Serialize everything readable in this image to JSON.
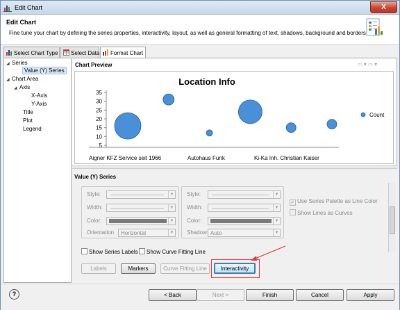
{
  "window": {
    "title": "Edit Chart",
    "close_label": "X"
  },
  "header": {
    "title": "Edit Chart",
    "description": "Fine tune your chart by defining the series properties, interactivity, layout, as well as general formatting of text, shadows, background and borders."
  },
  "tabs": [
    {
      "label": "Select Chart Type"
    },
    {
      "label": "Select Data"
    },
    {
      "label": "Format Chart"
    }
  ],
  "tree": {
    "series": "Series",
    "value_series": "Value (Y) Series",
    "chart_area": "Chart Area",
    "axis": "Axis",
    "x_axis": "X-Axis",
    "y_axis": "Y-Axis",
    "title": "Title",
    "plot": "Plot",
    "legend": "Legend"
  },
  "preview": {
    "heading": "Chart Preview",
    "nav_arrows": "⇦ ▾ ⇨ ▾"
  },
  "chart_data": {
    "type": "scatter",
    "title": "Location Info",
    "y_ticks": [
      5,
      10,
      15,
      20,
      25,
      30,
      35
    ],
    "ylim": [
      5,
      35
    ],
    "x_tick_labels": [
      "Aigner KFZ Service seit 1966",
      "Autohaus Funk",
      "Ki-Ka Inh. Christian Kaiser"
    ],
    "legend": "Count",
    "legend_position": "right",
    "series": [
      {
        "name": "Count",
        "color": "#4a90d9",
        "points": [
          {
            "x": 1,
            "y": 16,
            "size": 38
          },
          {
            "x": 2,
            "y": 31,
            "size": 16
          },
          {
            "x": 3,
            "y": 12,
            "size": 9
          },
          {
            "x": 4,
            "y": 24,
            "size": 34
          },
          {
            "x": 5,
            "y": 15,
            "size": 14
          },
          {
            "x": 6,
            "y": 17,
            "size": 14
          }
        ]
      }
    ]
  },
  "props": {
    "heading": "Value (Y) Series",
    "style_label": "Style:",
    "width_label": "Width:",
    "color_label": "Color:",
    "orientation_label": "Orientation",
    "orientation_value": "Horizontal",
    "shadow_label": "Shadow:",
    "shadow_value": "Auto",
    "use_palette": "Use Series Palette as Line Color",
    "show_curves": "Show Lines as Curves",
    "show_series_labels": "Show Series Labels",
    "show_curve_fitting": "Show Curve Fitting Line",
    "labels_btn": "Labels",
    "markers_btn": "Markers",
    "curve_btn": "Curve Fitting Line",
    "interactivity_btn": "Interactivity"
  },
  "footer": {
    "help": "?",
    "back": "< Back",
    "next": "Next >",
    "finish": "Finish",
    "cancel": "Cancel",
    "apply": "Apply"
  },
  "colors": {
    "bubble": "#4a90d9",
    "bubble_stroke": "#1f5e9e",
    "highlight": "#e23b2e"
  }
}
